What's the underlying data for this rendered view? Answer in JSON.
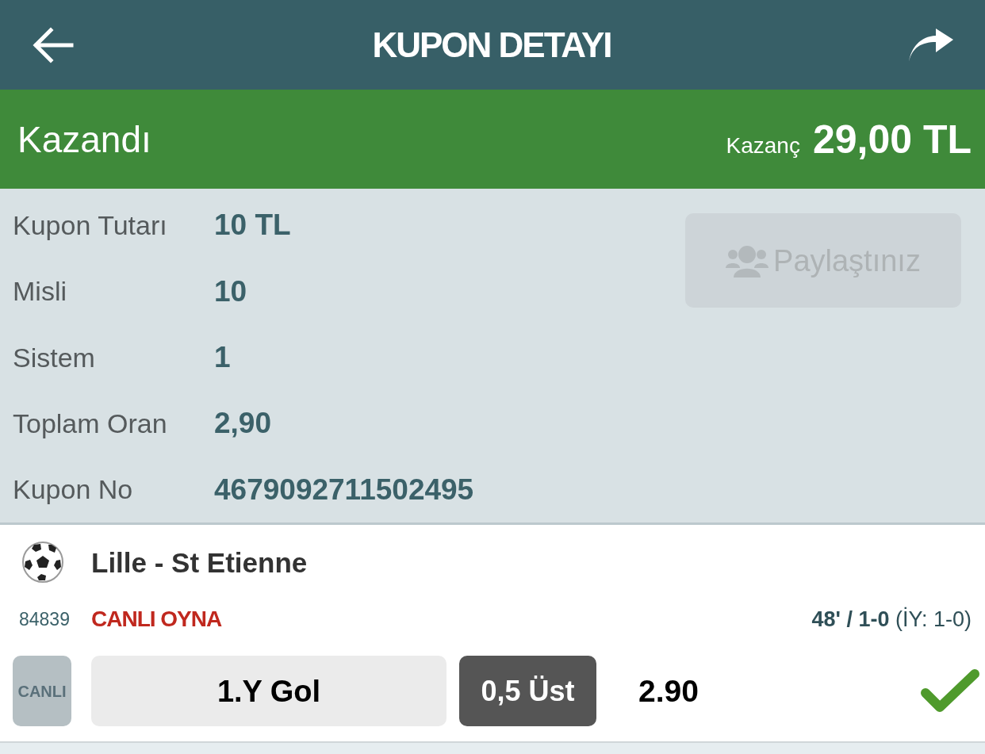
{
  "header": {
    "title": "KUPON DETAYI"
  },
  "status": {
    "kind": "won",
    "label": "Kazandı",
    "winnings_label": "Kazanç",
    "winnings": "29,00 TL"
  },
  "summary": [
    {
      "label": "Kupon Tutarı",
      "value": "10 TL"
    },
    {
      "label": "Misli",
      "value": "10"
    },
    {
      "label": "Sistem",
      "value": "1"
    },
    {
      "label": "Toplam Oran",
      "value": "2,90"
    },
    {
      "label": "Kupon No",
      "value": "4679092711502495"
    }
  ],
  "share_button": {
    "label": "Paylaştınız",
    "disabled": true
  },
  "matches": [
    {
      "teams": "Lille - St Etienne",
      "code": "84839",
      "live_link": "CANLI OYNA",
      "score": "**48' / 1-0** (İY: 1-0)",
      "live_badge": "CANLI",
      "market": "1.Y Gol",
      "pick": "0,5 Üst",
      "odds": "2.90",
      "won": true
    }
  ]
}
